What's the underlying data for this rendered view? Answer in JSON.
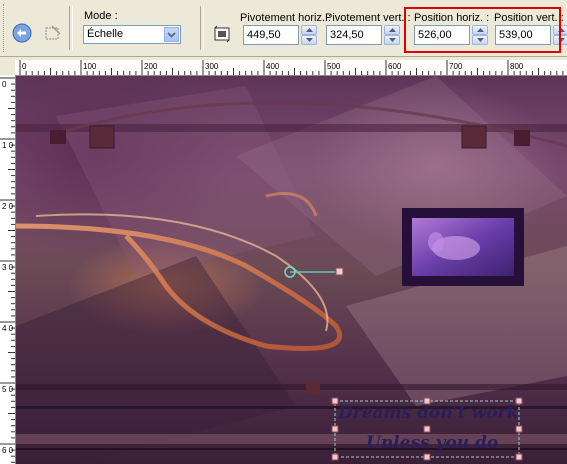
{
  "toolbar": {
    "mode_label": "Mode :",
    "mode_value": "Échelle",
    "pivot_h_label": "Pivotement horiz. :",
    "pivot_h_value": "449,50",
    "pivot_v_label": "Pivotement vert. :",
    "pivot_v_value": "324,50",
    "pos_h_label": "Position horiz. :",
    "pos_h_value": "526,00",
    "pos_v_label": "Position vert. :",
    "pos_v_value": "539,00"
  },
  "ruler": {
    "h_ticks": [
      "0",
      "100",
      "200",
      "300",
      "400",
      "500",
      "600",
      "700",
      "800"
    ],
    "v_ticks": [
      "0",
      "100",
      "200",
      "300",
      "400",
      "500",
      "600"
    ]
  },
  "canvas": {
    "text_line1": "Dreams don't work",
    "text_line2": "Unless you do"
  },
  "colors": {
    "highlight": "#e00000",
    "toolbar_bg": "#ece9d8",
    "selection_handle": "#f2c8cf"
  }
}
